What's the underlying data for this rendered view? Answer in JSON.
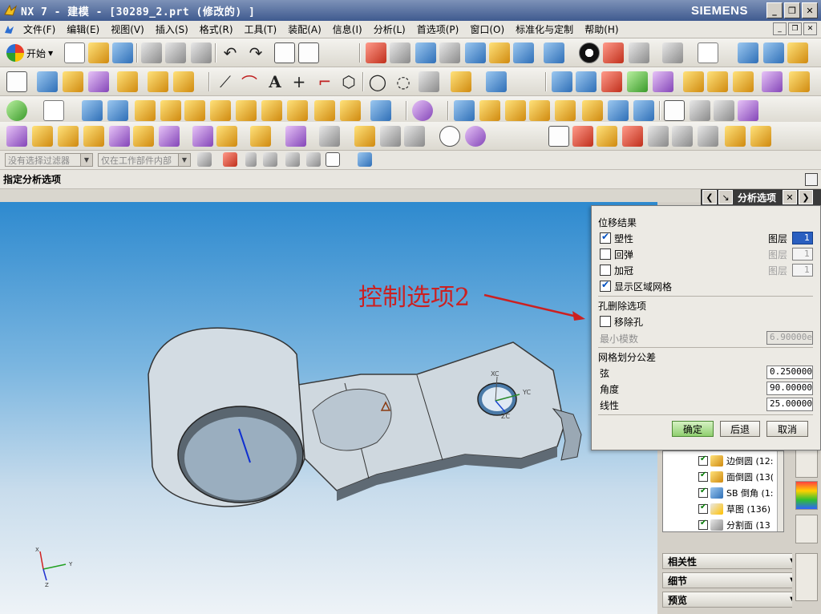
{
  "window": {
    "title": "NX 7 - 建模 - [30289_2.prt  (修改的) ]",
    "brand": "SIEMENS",
    "buttons": {
      "minimize": "_",
      "restore": "❐",
      "close": "✕"
    }
  },
  "menubar": {
    "items": [
      "文件(F)",
      "编辑(E)",
      "视图(V)",
      "插入(S)",
      "格式(R)",
      "工具(T)",
      "装配(A)",
      "信息(I)",
      "分析(L)",
      "首选项(P)",
      "窗口(O)",
      "标准化与定制",
      "帮助(H)"
    ]
  },
  "toolbar": {
    "start_label": "开始",
    "text_tool": "A",
    "plus_tool": "+"
  },
  "filterbar": {
    "type_filter": "没有选择过滤器",
    "scope_filter": "仅在工作部件内部"
  },
  "cue": {
    "text": "指定分析选项"
  },
  "analysis_dialog": {
    "title": "分析选项",
    "groups": {
      "displacement": "位移结果",
      "hole_removal": "孔删除选项",
      "mesh_tolerance": "网格划分公差"
    },
    "options": {
      "plasticity": {
        "label": "塑性",
        "checked": true,
        "layer_label": "图层",
        "layer_value": "1"
      },
      "springback": {
        "label": "回弹",
        "checked": false,
        "layer_label": "图层",
        "layer_value": "1"
      },
      "crowning": {
        "label": "加冠",
        "checked": false,
        "layer_label": "图层",
        "layer_value": "1"
      },
      "show_region_mesh": {
        "label": "显示区域网格",
        "checked": true
      },
      "remove_holes": {
        "label": "移除孔",
        "checked": false
      }
    },
    "min_modulus": {
      "label": "最小模数",
      "value": "6.90000e"
    },
    "chord": {
      "label": "弦",
      "value": "0.250000"
    },
    "angle": {
      "label": "角度",
      "value": "90.000000"
    },
    "linearity": {
      "label": "线性",
      "value": "25.000000"
    },
    "buttons": {
      "ok": "确定",
      "back": "后退",
      "cancel": "取消"
    }
  },
  "annotation": {
    "text": "控制选项2"
  },
  "viewport": {
    "triad": {
      "x": "X",
      "y": "Y",
      "z": "Z"
    },
    "wcs": {
      "xc": "XC",
      "yc": "YC",
      "zc": "ZC"
    }
  },
  "part_navigator": {
    "items": [
      {
        "label": "边倒圆 (12:"
      },
      {
        "label": "面倒圆 (13("
      },
      {
        "label": "SB 倒角 (1:"
      },
      {
        "label": "草图 (136)"
      },
      {
        "label": "分割面 (13"
      }
    ],
    "sections": [
      "相关性",
      "细节",
      "预览"
    ]
  },
  "colors": {
    "titlebar": "#3f5a8f",
    "viewport_top": "#2e8acf",
    "viewport_bottom": "#eef3f7",
    "annotation": "#cc2020",
    "ok_button": "#8fcf6f"
  }
}
